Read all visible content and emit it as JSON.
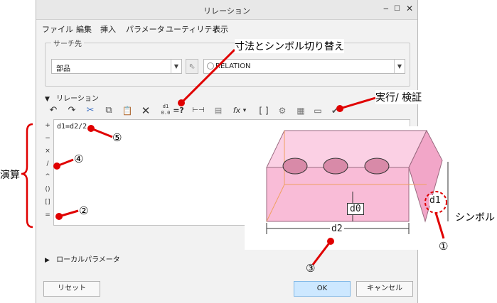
{
  "window": {
    "title": "リレーション",
    "minimize": "‒",
    "maximize": "☐",
    "close": "✕"
  },
  "menu": [
    "ファイル",
    "編集",
    "挿入",
    "パラメータ",
    "ユーティリティ",
    "表示"
  ],
  "search": {
    "group_label": "サーチ先",
    "target_value": "部品",
    "target_arrow": "▼",
    "relation_value": "RELATION",
    "relation_arrow": "▼"
  },
  "relations_section": {
    "label": "リレーション",
    "toggle": "▼"
  },
  "toolbar": {
    "undo": "↶",
    "redo": "↷",
    "cut": "✂",
    "copy": "⧉",
    "paste": "📋",
    "delete": "✕",
    "dim_toggle_top": "d1",
    "dim_toggle_bottom": "0.0",
    "eval": "=?",
    "measure": "⊢⊣",
    "function": "fx",
    "function_arrow": "▾",
    "brackets": "[ ]",
    "verify": "✔"
  },
  "operators": [
    "+",
    "−",
    "×",
    "/",
    "^",
    "()",
    "[]",
    "="
  ],
  "editor": {
    "text": "d1=d2/2"
  },
  "local_params": {
    "label": "ローカルパラメータ",
    "toggle": "▶"
  },
  "buttons": {
    "reset": "リセット",
    "ok": "OK",
    "cancel": "キャンセル"
  },
  "annotations": {
    "dim_symbol_toggle": "寸法とシンボル切り替え",
    "exec_verify": "実行/ 検証",
    "operators": "演算",
    "symbol": "シンボル",
    "m1": "①",
    "m2": "②",
    "m3": "③",
    "m4": "④",
    "m5": "⑤"
  },
  "model": {
    "d0": "d0",
    "d1": "d1",
    "d2": "d2"
  },
  "colors": {
    "accent_red": "#e00000",
    "block_front": "#f7b6d2",
    "block_top": "#fcd4e6",
    "ok_button": "#cde8ff"
  }
}
